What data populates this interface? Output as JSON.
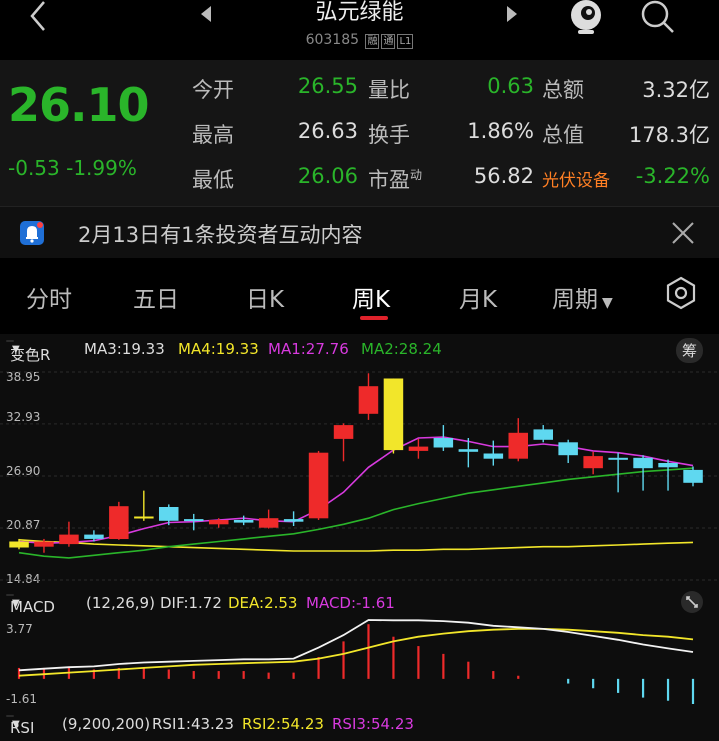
{
  "header": {
    "title": "弘元绿能",
    "code": "603185",
    "tags": [
      "融",
      "通",
      "L1"
    ]
  },
  "quote": {
    "price": "26.10",
    "change": "-0.53",
    "change_pct": "-1.99%",
    "open_label": "今开",
    "open": "26.55",
    "high_label": "最高",
    "high": "26.63",
    "low_label": "最低",
    "low": "26.06",
    "vol_ratio_label": "量比",
    "vol_ratio": "0.63",
    "turnover_label": "换手",
    "turnover": "1.86%",
    "pe_label": "市盈",
    "pe_sup": "动",
    "pe": "56.82",
    "amount_label": "总额",
    "amount": "3.32亿",
    "mktcap_label": "总值",
    "mktcap": "178.3亿",
    "sector_name": "光伏设备",
    "sector_change": "-3.22%"
  },
  "notice": {
    "text": "2月13日有1条投资者互动内容"
  },
  "tabs": [
    {
      "label": "分时"
    },
    {
      "label": "五日"
    },
    {
      "label": "日K"
    },
    {
      "label": "周K"
    },
    {
      "label": "月K"
    },
    {
      "label": "周期"
    }
  ],
  "main_indicator": {
    "selector": "变色R",
    "ma3": "MA3:19.33",
    "ma4": "MA4:19.33",
    "ma1": "MA1:27.76",
    "ma2": "MA2:28.24",
    "chip_label": "筹"
  },
  "macd_indicator": {
    "selector": "MACD",
    "params": "(12,26,9)",
    "dif": "DIF:1.72",
    "dea": "DEA:2.53",
    "macd": "MACD:-1.61"
  },
  "rsi_indicator": {
    "selector": "RSI",
    "params": "(9,200,200)",
    "rsi1": "RSI1:43.23",
    "rsi2": "RSI2:54.23",
    "rsi3": "RSI3:54.23"
  },
  "colors": {
    "up": "#ee2a2a",
    "down": "#5fd8f0",
    "green": "#2ab52a",
    "yellow": "#f2e62a",
    "magenta": "#d83adf"
  },
  "chart_data": [
    {
      "type": "candlestick",
      "y_ticks": [
        "38.95",
        "32.93",
        "26.90",
        "20.87",
        "14.84"
      ],
      "ylim": [
        14.84,
        38.95
      ],
      "candles": [
        {
          "o": 19.3,
          "c": 18.6,
          "h": 19.6,
          "l": 18.4,
          "color": "yellow"
        },
        {
          "o": 18.7,
          "c": 19.3,
          "h": 19.6,
          "l": 18.0,
          "color": "up"
        },
        {
          "o": 19.0,
          "c": 20.1,
          "h": 21.6,
          "l": 18.7,
          "color": "up"
        },
        {
          "o": 20.1,
          "c": 19.6,
          "h": 20.6,
          "l": 19.3,
          "color": "down"
        },
        {
          "o": 19.6,
          "c": 23.4,
          "h": 23.9,
          "l": 19.5,
          "color": "up"
        },
        {
          "o": 22.2,
          "c": 22.2,
          "h": 25.2,
          "l": 21.7,
          "color": "yellow"
        },
        {
          "o": 23.3,
          "c": 21.7,
          "h": 23.6,
          "l": 21.2,
          "color": "down"
        },
        {
          "o": 21.9,
          "c": 21.7,
          "h": 22.5,
          "l": 20.6,
          "color": "down"
        },
        {
          "o": 21.3,
          "c": 21.8,
          "h": 22.0,
          "l": 20.9,
          "color": "up"
        },
        {
          "o": 21.8,
          "c": 21.5,
          "h": 22.3,
          "l": 21.2,
          "color": "down"
        },
        {
          "o": 20.9,
          "c": 22.0,
          "h": 23.0,
          "l": 20.8,
          "color": "up"
        },
        {
          "o": 21.9,
          "c": 21.6,
          "h": 22.8,
          "l": 21.1,
          "color": "down"
        },
        {
          "o": 22.0,
          "c": 29.6,
          "h": 29.8,
          "l": 21.8,
          "color": "up"
        },
        {
          "o": 31.2,
          "c": 32.8,
          "h": 33.0,
          "l": 28.6,
          "color": "up"
        },
        {
          "o": 34.1,
          "c": 37.3,
          "h": 38.8,
          "l": 33.4,
          "color": "up"
        },
        {
          "o": 38.2,
          "c": 29.9,
          "h": 38.2,
          "l": 29.5,
          "color": "yellow"
        },
        {
          "o": 29.8,
          "c": 30.3,
          "h": 31.2,
          "l": 28.9,
          "color": "up"
        },
        {
          "o": 31.3,
          "c": 30.2,
          "h": 32.8,
          "l": 29.8,
          "color": "down"
        },
        {
          "o": 30.0,
          "c": 29.7,
          "h": 31.3,
          "l": 27.9,
          "color": "down"
        },
        {
          "o": 29.5,
          "c": 28.9,
          "h": 31.0,
          "l": 28.1,
          "color": "down"
        },
        {
          "o": 28.9,
          "c": 31.9,
          "h": 33.6,
          "l": 28.6,
          "color": "up"
        },
        {
          "o": 32.3,
          "c": 31.1,
          "h": 32.8,
          "l": 30.8,
          "color": "down"
        },
        {
          "o": 30.8,
          "c": 29.3,
          "h": 31.1,
          "l": 28.4,
          "color": "down"
        },
        {
          "o": 27.8,
          "c": 29.2,
          "h": 29.7,
          "l": 27.1,
          "color": "up"
        },
        {
          "o": 29.0,
          "c": 28.9,
          "h": 29.6,
          "l": 25.0,
          "color": "down"
        },
        {
          "o": 29.0,
          "c": 27.8,
          "h": 29.3,
          "l": 25.2,
          "color": "down"
        },
        {
          "o": 28.4,
          "c": 27.9,
          "h": 28.8,
          "l": 25.2,
          "color": "down"
        },
        {
          "o": 27.6,
          "c": 26.1,
          "h": 28.0,
          "l": 25.7,
          "color": "down"
        }
      ],
      "ma_magenta": [
        19.3,
        19.1,
        19.2,
        19.4,
        20.0,
        20.8,
        21.5,
        21.6,
        21.8,
        22.0,
        21.7,
        21.6,
        23.0,
        25.0,
        27.9,
        29.9,
        31.3,
        31.4,
        30.9,
        30.3,
        30.3,
        30.6,
        30.3,
        29.8,
        29.6,
        29.2,
        28.6,
        28.1
      ],
      "ma_green": [
        18.0,
        17.6,
        17.4,
        17.7,
        18.0,
        18.3,
        18.7,
        19.0,
        19.3,
        19.6,
        19.9,
        20.2,
        20.7,
        21.3,
        22.0,
        23.0,
        23.7,
        24.3,
        24.9,
        25.3,
        25.7,
        26.1,
        26.5,
        26.8,
        27.1,
        27.4,
        27.6,
        27.8
      ],
      "ma_yellow": [
        19.5,
        19.3,
        19.2,
        19.0,
        18.9,
        18.8,
        18.7,
        18.6,
        18.5,
        18.4,
        18.3,
        18.2,
        18.2,
        18.2,
        18.2,
        18.3,
        18.3,
        18.4,
        18.4,
        18.5,
        18.6,
        18.7,
        18.7,
        18.8,
        18.9,
        19.0,
        19.1,
        19.2
      ]
    },
    {
      "type": "macd",
      "y_ticks": [
        "3.77",
        "-1.61"
      ],
      "ylim": [
        -1.61,
        3.77
      ],
      "dif": [
        0.55,
        0.65,
        0.75,
        0.8,
        0.95,
        1.05,
        1.1,
        1.15,
        1.2,
        1.25,
        1.25,
        1.3,
        2.0,
        2.8,
        3.77,
        3.75,
        3.75,
        3.7,
        3.6,
        3.4,
        3.3,
        3.2,
        3.0,
        2.75,
        2.5,
        2.2,
        1.95,
        1.72
      ],
      "dea": [
        0.2,
        0.3,
        0.4,
        0.5,
        0.6,
        0.7,
        0.8,
        0.9,
        0.95,
        1.0,
        1.05,
        1.1,
        1.3,
        1.6,
        2.0,
        2.4,
        2.7,
        2.9,
        3.05,
        3.15,
        3.2,
        3.2,
        3.15,
        3.05,
        2.95,
        2.8,
        2.7,
        2.53
      ],
      "macd": [
        0.7,
        0.7,
        0.7,
        0.6,
        0.7,
        0.7,
        0.6,
        0.5,
        0.5,
        0.5,
        0.4,
        0.4,
        1.4,
        2.4,
        3.5,
        2.7,
        2.1,
        1.6,
        1.1,
        0.5,
        0.2,
        0.0,
        -0.3,
        -0.6,
        -0.9,
        -1.2,
        -1.4,
        -1.61
      ]
    }
  ]
}
